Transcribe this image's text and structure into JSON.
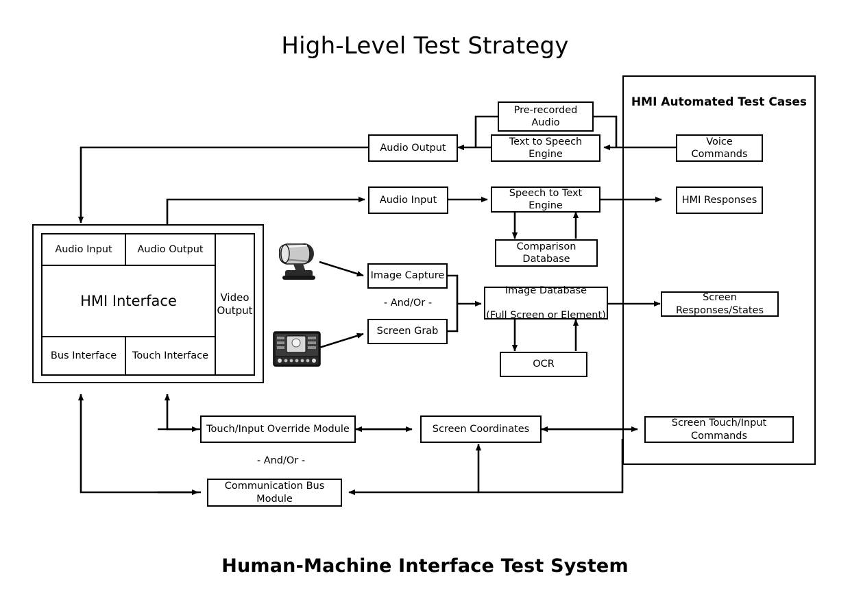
{
  "title": "High-Level Test Strategy",
  "caption": "Human-Machine Interface Test System",
  "panel": {
    "title": "HMI Automated Test Cases"
  },
  "hmi": {
    "audio_input": "Audio Input",
    "audio_output": "Audio Output",
    "main": "HMI Interface",
    "video_output": "Video\nOutput",
    "video_output_line1": "Video",
    "video_output_line2": "Output",
    "bus_interface": "Bus Interface",
    "touch_interface": "Touch Interface"
  },
  "boxes": {
    "pre_recorded_audio": "Pre-recorded Audio",
    "text_to_speech": "Text to Speech Engine",
    "audio_output": "Audio Output",
    "audio_input": "Audio Input",
    "speech_to_text": "Speech to Text Engine",
    "comparison_database": "Comparison Database",
    "image_capture": "Image Capture",
    "screen_grab": "Screen Grab",
    "image_database_line1": "Image Database",
    "image_database_line2": "(Full Screen or Element)",
    "ocr": "OCR",
    "touch_override": "Touch/Input Override Module",
    "screen_coordinates": "Screen Coordinates",
    "comm_bus": "Communication Bus Module",
    "voice_commands": "Voice Commands",
    "hmi_responses": "HMI Responses",
    "screen_responses": "Screen Responses/States",
    "screen_touch_commands": "Screen Touch/Input Commands"
  },
  "labels": {
    "andor_capture": "- And/Or -",
    "andor_input": "- And/Or -"
  },
  "icons": {
    "webcam": "webcam-camera-photo",
    "head_unit": "car-head-unit-photo"
  },
  "colors": {
    "stroke": "#000000",
    "background": "#ffffff"
  }
}
